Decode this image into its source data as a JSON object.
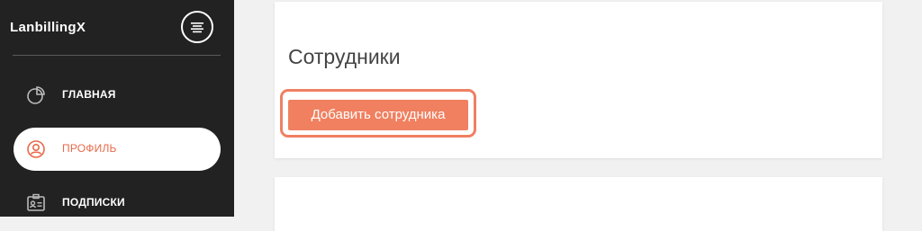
{
  "sidebar": {
    "brand": "LanbillingX",
    "items": [
      {
        "label": "ГЛАВНАЯ",
        "icon": "pie-chart-icon",
        "active": false
      },
      {
        "label": "ПРОФИЛЬ",
        "icon": "user-circle-icon",
        "active": true
      },
      {
        "label": "ПОДПИСКИ",
        "icon": "id-card-icon",
        "active": false
      }
    ]
  },
  "main": {
    "title": "Сотрудники",
    "add_button_label": "Добавить сотрудника"
  },
  "colors": {
    "sidebar_bg": "#222222",
    "accent": "#f08060",
    "active_label": "#e8694a"
  }
}
